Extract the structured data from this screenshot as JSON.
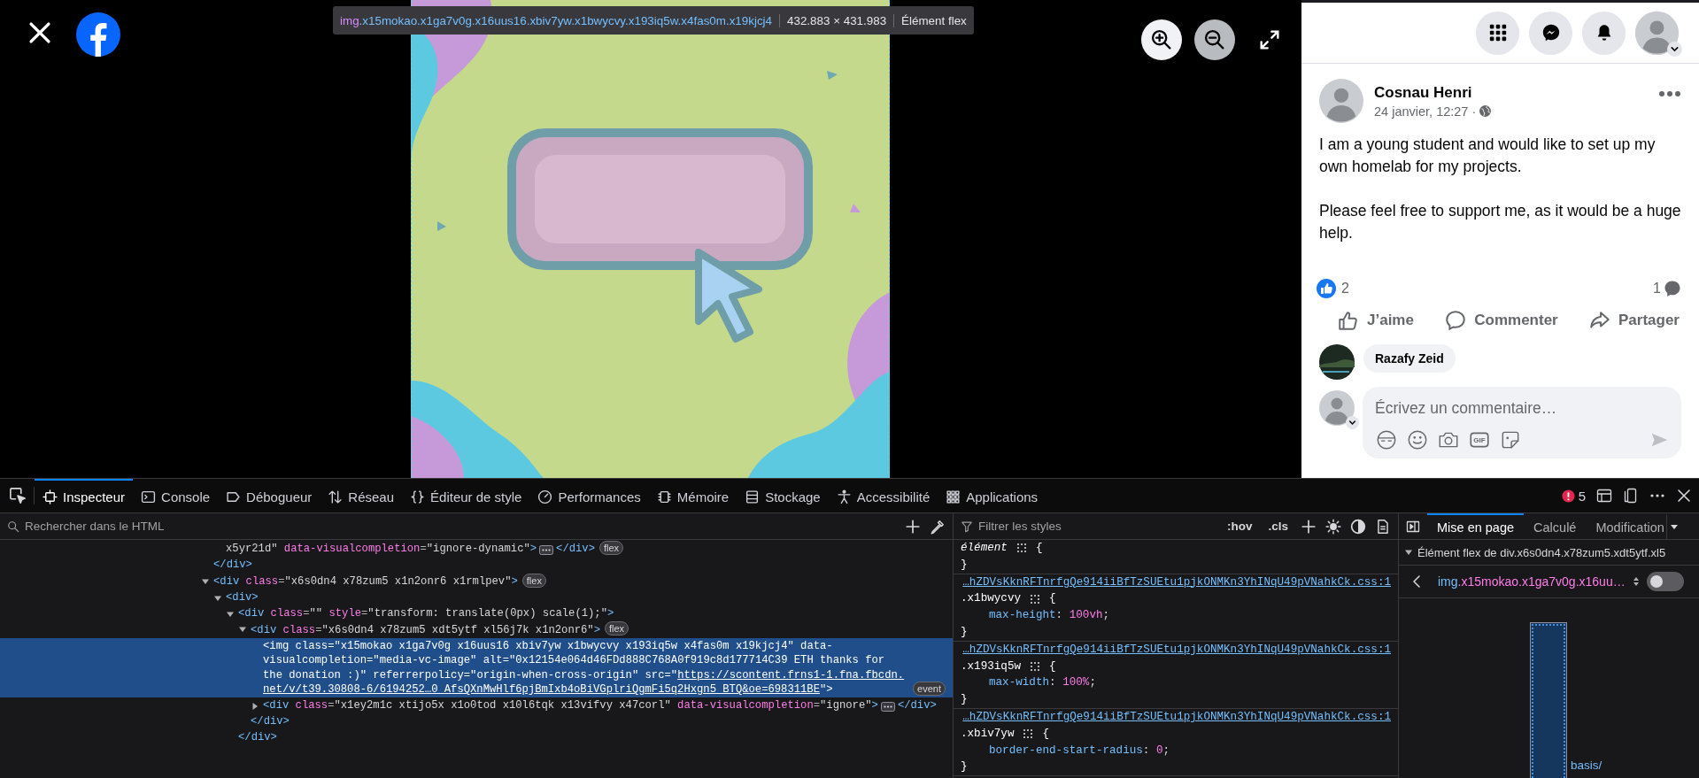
{
  "viewer": {
    "controls": [
      {
        "kind": "zoom-in",
        "disabled": false
      },
      {
        "kind": "zoom-out",
        "disabled": true
      },
      {
        "kind": "fullscreen",
        "disabled": false
      }
    ],
    "tooltip": {
      "tag": "img",
      "classes": ".x15mokao.x1ga7v0g.x16uus16.xbiv7yw.x1bwycvy.x193iq5w.x4fas0m.x19kjcj4",
      "size": "432.883 × 431.983",
      "role": "Élément flex"
    }
  },
  "post_panel": {
    "top_buttons": [
      {
        "kind": "menu"
      },
      {
        "kind": "messenger"
      },
      {
        "kind": "notifications"
      },
      {
        "kind": "account"
      }
    ],
    "post": {
      "author": "Cosnau Henri",
      "time": "24 janvier, 12:27",
      "separator": "·",
      "paragraphs": [
        "I am a young student and would like to set up my own homelab for my projects.",
        "Please feel free to support me, as it would be a huge help."
      ],
      "reaction_count": "2",
      "comment_count": "1",
      "actions": [
        {
          "kind": "like",
          "label": "J’aime"
        },
        {
          "kind": "comment",
          "label": "Commenter"
        },
        {
          "kind": "share",
          "label": "Partager"
        }
      ]
    },
    "comments": [
      {
        "author": "Razafy Zeid"
      }
    ],
    "composer": {
      "placeholder": "Écrivez un commentaire…",
      "tools": [
        {
          "kind": "avatar"
        },
        {
          "kind": "emoji"
        },
        {
          "kind": "camera"
        },
        {
          "kind": "gif",
          "label": "GIF"
        },
        {
          "kind": "sticker"
        }
      ]
    }
  },
  "devtools": {
    "tabs": [
      {
        "kind": "inspector",
        "label": "Inspecteur",
        "selected": true
      },
      {
        "kind": "console",
        "label": "Console",
        "selected": false
      },
      {
        "kind": "debugger",
        "label": "Débogueur",
        "selected": false
      },
      {
        "kind": "network",
        "label": "Réseau",
        "selected": false
      },
      {
        "kind": "style-editor",
        "label": "Éditeur de style",
        "selected": false
      },
      {
        "kind": "performance",
        "label": "Performances",
        "selected": false
      },
      {
        "kind": "memory",
        "label": "Mémoire",
        "selected": false
      },
      {
        "kind": "storage",
        "label": "Stockage",
        "selected": false
      },
      {
        "kind": "accessibility",
        "label": "Accessibilité",
        "selected": false
      },
      {
        "kind": "application",
        "label": "Applications",
        "selected": false
      }
    ],
    "error_count": "5",
    "html_search": {
      "placeholder": "Rechercher dans le HTML"
    },
    "markup": [
      {
        "children": [
          {
            "selected": false,
            "open": [
              {
                "kind": "value",
                "text": "x5yr21d\""
              },
              {
                "kind": "attr",
                "text": " data-visualcompletion"
              },
              {
                "kind": "punct",
                "text": "="
              },
              {
                "kind": "value",
                "text": "\"ignore-dynamic\""
              },
              {
                "kind": "tag",
                "text": ">"
              }
            ],
            "collapsed": true,
            "inline_close": [
              {
                "kind": "tag",
                "text": "</div>"
              }
            ],
            "badges": [
              "flex"
            ]
          }
        ],
        "close": [
          {
            "kind": "tag",
            "text": "</div>"
          }
        ]
      },
      {
        "selected": false,
        "expanded": true,
        "open": [
          {
            "kind": "tag",
            "text": "<div"
          },
          {
            "kind": "attr",
            "text": " class"
          },
          {
            "kind": "punct",
            "text": "="
          },
          {
            "kind": "value",
            "text": "\"x6s0dn4 x78zum5 x1n2onr6 x1rmlpev\""
          },
          {
            "kind": "tag",
            "text": ">"
          }
        ],
        "badges": [
          "flex"
        ],
        "children": [
          {
            "selected": false,
            "expanded": true,
            "open": [
              {
                "kind": "tag",
                "text": "<div>"
              }
            ],
            "children": [
              {
                "selected": false,
                "expanded": true,
                "open": [
                  {
                    "kind": "tag",
                    "text": "<div"
                  },
                  {
                    "kind": "attr",
                    "text": " class"
                  },
                  {
                    "kind": "punct",
                    "text": "="
                  },
                  {
                    "kind": "value",
                    "text": "\"\""
                  },
                  {
                    "kind": "attr",
                    "text": " style"
                  },
                  {
                    "kind": "punct",
                    "text": "="
                  },
                  {
                    "kind": "value",
                    "text": "\"transform: translate(0px) scale(1);\""
                  },
                  {
                    "kind": "tag",
                    "text": ">"
                  }
                ],
                "children": [
                  {
                    "selected": false,
                    "expanded": true,
                    "open": [
                      {
                        "kind": "tag",
                        "text": "<div"
                      },
                      {
                        "kind": "attr",
                        "text": " class"
                      },
                      {
                        "kind": "punct",
                        "text": "="
                      },
                      {
                        "kind": "value",
                        "text": "\"x6s0dn4 x78zum5 xdt5ytf xl56j7k x1n2onr6\""
                      },
                      {
                        "kind": "tag",
                        "text": ">"
                      }
                    ],
                    "badges": [
                      "flex"
                    ],
                    "children": [
                      {
                        "selected": true,
                        "open": [
                          {
                            "kind": "tag",
                            "text": "<img"
                          },
                          {
                            "kind": "attr",
                            "text": " class"
                          },
                          {
                            "kind": "punct",
                            "text": "="
                          },
                          {
                            "kind": "value",
                            "text": "\"x15mokao x1ga7v0g x16uus16 xbiv7yw x1bwycvy x193iq5w x4fas0m x19kjcj4\""
                          },
                          {
                            "kind": "attr",
                            "text": " data-visualcompletion"
                          },
                          {
                            "kind": "punct",
                            "text": "="
                          },
                          {
                            "kind": "value",
                            "text": "\"media-vc-image\""
                          },
                          {
                            "kind": "attr",
                            "text": " alt"
                          },
                          {
                            "kind": "punct",
                            "text": "="
                          },
                          {
                            "kind": "value",
                            "text": "\"0x12154e064d46FDd888C768A0f919c8d177714C39 ETH thanks for the donation :)\""
                          },
                          {
                            "kind": "attr",
                            "text": " referrerpolicy"
                          },
                          {
                            "kind": "punct",
                            "text": "="
                          },
                          {
                            "kind": "value",
                            "text": "\"origin-when-cross-origin\""
                          },
                          {
                            "kind": "attr",
                            "text": " src"
                          },
                          {
                            "kind": "punct",
                            "text": "=\""
                          },
                          {
                            "kind": "link",
                            "text": "https://scontent.frns1-1.fna.fbcdn.net/v/t39.30808-6/6194252…0_AfsQXnMwHlf6pjBmIxb4oBiVGplriQgmFi5q2Hxgn5_BTQ&oe=698311BE"
                          },
                          {
                            "kind": "punct",
                            "text": "\""
                          },
                          {
                            "kind": "tag",
                            "text": ">"
                          }
                        ],
                        "badges": [
                          "event"
                        ]
                      },
                      {
                        "selected": false,
                        "expanded": false,
                        "open": [
                          {
                            "kind": "tag",
                            "text": "<div"
                          },
                          {
                            "kind": "attr",
                            "text": " class"
                          },
                          {
                            "kind": "punct",
                            "text": "="
                          },
                          {
                            "kind": "value",
                            "text": "\"x1ey2m1c xtijo5x x1o0tod x10l6tqk x13vifvy x47corl\""
                          },
                          {
                            "kind": "attr",
                            "text": " data-visualcompletion"
                          },
                          {
                            "kind": "punct",
                            "text": "="
                          },
                          {
                            "kind": "value",
                            "text": "\"ignore\""
                          },
                          {
                            "kind": "tag",
                            "text": ">"
                          }
                        ],
                        "collapsed": true,
                        "inline_close": [
                          {
                            "kind": "tag",
                            "text": "</div>"
                          }
                        ]
                      }
                    ],
                    "close": [
                      {
                        "kind": "tag",
                        "text": "</div>"
                      }
                    ]
                  }
                ],
                "close": [
                  {
                    "kind": "tag",
                    "text": "</div>"
                  }
                ]
              }
            ]
          }
        ]
      }
    ],
    "styles_filter": {
      "placeholder": "Filtrer les styles"
    },
    "style_toggles": [
      ":hov",
      ".cls"
    ],
    "rules": [
      {
        "kind": "element",
        "selector": "élément",
        "open": "{",
        "close": "}"
      },
      {
        "kind": "class",
        "source": "…hZDVsKknRFTnrfgQe914iiBfTzSUEtu1pjkONMKn3YhINqU49pVNahkCk.css:1",
        "selector": ".x1bwycvy",
        "open": "{",
        "declarations": [
          {
            "property": "max-height",
            "colon": ":",
            "value": "100vh",
            "end": ";"
          }
        ],
        "close": "}"
      },
      {
        "kind": "class",
        "source": "…hZDVsKknRFTnrfgQe914iiBfTzSUEtu1pjkONMKn3YhINqU49pVNahkCk.css:1",
        "selector": ".x193iq5w",
        "open": "{",
        "declarations": [
          {
            "property": "max-width",
            "colon": ":",
            "value": "100%",
            "end": ";"
          }
        ],
        "close": "}"
      },
      {
        "kind": "class",
        "source": "…hZDVsKknRFTnrfgQe914iiBfTzSUEtu1pjkONMKn3YhINqU49pVNahkCk.css:1",
        "selector": ".xbiv7yw",
        "open": "{",
        "declarations": [
          {
            "property": "border-end-start-radius",
            "colon": ":",
            "value": "0",
            "end": ";"
          }
        ],
        "close": "}"
      }
    ],
    "side_tabs": [
      {
        "label": "Mise en page",
        "selected": true
      },
      {
        "label": "Calculé",
        "selected": false
      },
      {
        "label": "Modification",
        "selected": false
      }
    ],
    "flex_section": {
      "title": "Élément flex de div.x6s0dn4.x78zum5.xdt5ytf.xl5",
      "expanded": true
    },
    "flex_item": {
      "tag": "img",
      "classes": ".x15mokao.x1ga7v0g.x16uu…",
      "highlight": false
    },
    "diagram": {
      "label": "basis/"
    }
  }
}
